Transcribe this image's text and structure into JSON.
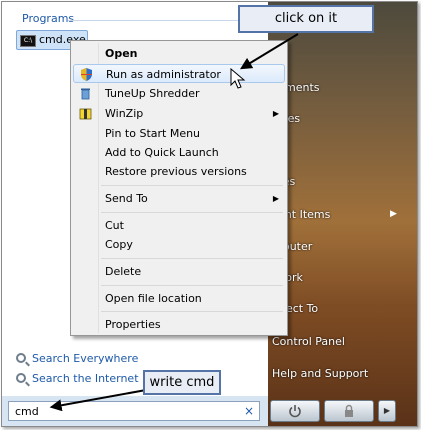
{
  "start_menu": {
    "programs_header": "Programs",
    "program_item": "cmd.exe",
    "program_icon_text": "C:\\",
    "search_everywhere": "Search Everywhere",
    "search_internet": "Search the Internet",
    "search_value": "cmd",
    "clear_icon": "×"
  },
  "right_pane": {
    "items": [
      {
        "label": "cuments",
        "icon": "none"
      },
      {
        "label": "tures",
        "icon": "none"
      },
      {
        "label": "sic",
        "icon": "none"
      },
      {
        "label": "mes",
        "icon": "none"
      },
      {
        "label": "cent Items",
        "icon": "submenu-arrow"
      },
      {
        "label": "mputer",
        "icon": "none"
      },
      {
        "label": "twork",
        "icon": "none"
      },
      {
        "label": "nnect To",
        "icon": "none"
      },
      {
        "label": "Control Panel",
        "icon": "none"
      },
      {
        "label": "Help and Support",
        "icon": "none"
      }
    ],
    "submenu_arrow": "▶"
  },
  "context_menu": {
    "items": [
      {
        "label": "Open",
        "bold": true
      },
      {
        "label": "Run as administrator",
        "icon": "shield-icon",
        "highlighted": true
      },
      {
        "label": "TuneUp Shredder",
        "icon": "trash-icon"
      },
      {
        "label": "WinZip",
        "icon": "winzip-icon",
        "submenu": true
      },
      {
        "label": "Pin to Start Menu"
      },
      {
        "label": "Add to Quick Launch"
      },
      {
        "label": "Restore previous versions"
      },
      {
        "label": "Send To",
        "submenu": true
      },
      {
        "label": "Cut"
      },
      {
        "label": "Copy"
      },
      {
        "label": "Delete"
      },
      {
        "label": "Open file location"
      },
      {
        "label": "Properties"
      }
    ],
    "submenu_arrow": "▶"
  },
  "callouts": {
    "top": "click on it",
    "bottom": "write cmd"
  },
  "power_buttons": {
    "power_icon": "power-icon",
    "lock_icon": "lock-icon",
    "arrow_label": "▶"
  },
  "colors": {
    "link_blue": "#1e5aa8",
    "callout_border": "#5474a8",
    "highlight": "#dceafb"
  }
}
